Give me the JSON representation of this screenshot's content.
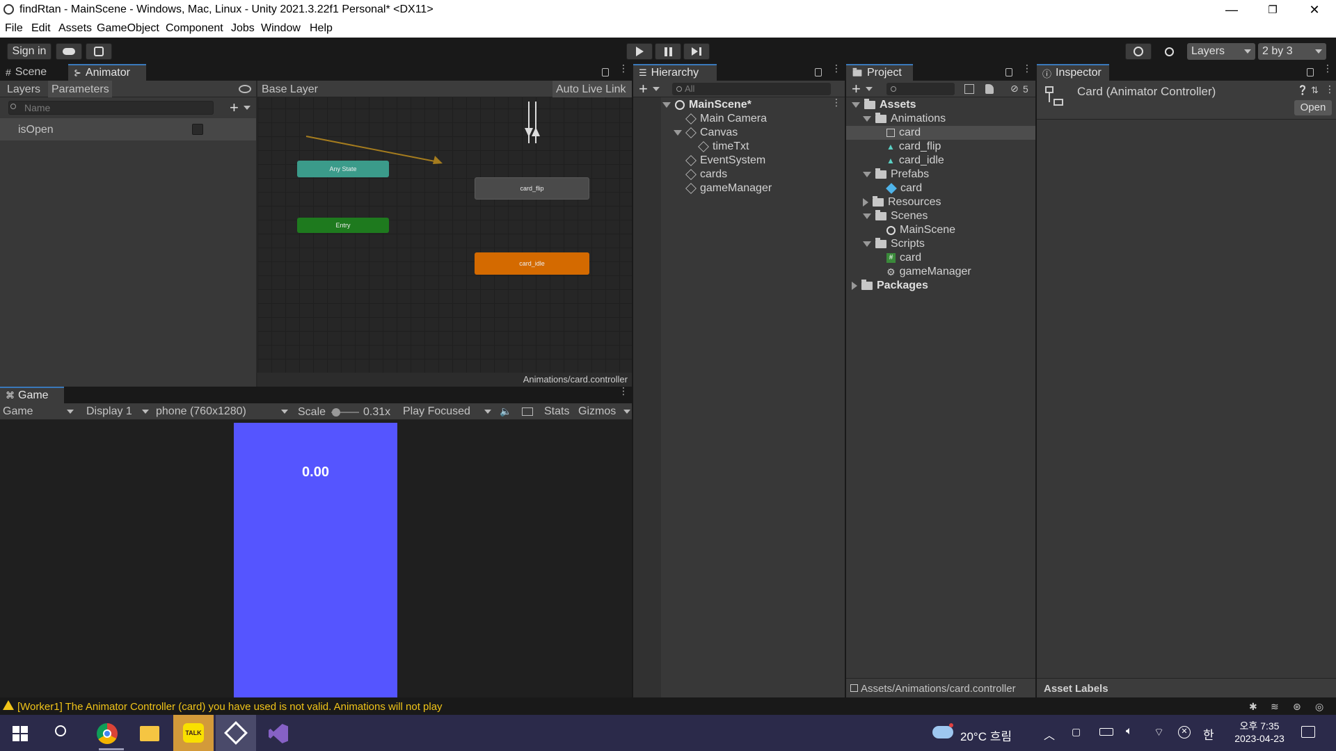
{
  "window": {
    "title": "findRtan - MainScene - Windows, Mac, Linux - Unity 2021.3.22f1 Personal* <DX11>",
    "minimize": "—",
    "restore": "❐",
    "close": "✕"
  },
  "menu": [
    "File",
    "Edit",
    "Assets",
    "GameObject",
    "Component",
    "Jobs",
    "Window",
    "Help"
  ],
  "toolbar": {
    "sign_in": "Sign in",
    "layers": "Layers",
    "layout": "2 by 3"
  },
  "scene_tabs": {
    "scene": "Scene",
    "animator": "Animator"
  },
  "animator": {
    "layers_tab": "Layers",
    "parameters_tab": "Parameters",
    "search_placeholder": "Name",
    "breadcrumb": "Base Layer",
    "auto_live_link": "Auto Live Link",
    "parameter": "isOpen",
    "nodes": {
      "any_state": "Any State",
      "entry": "Entry",
      "card_flip": "card_flip",
      "card_idle": "card_idle"
    },
    "footer": "Animations/card.controller"
  },
  "game": {
    "tab": "Game",
    "view_select": "Game",
    "display": "Display 1",
    "resolution": "phone (760x1280)",
    "scale_label": "Scale",
    "scale_value": "0.31x",
    "play_mode": "Play Focused",
    "stats": "Stats",
    "gizmos": "Gizmos",
    "timer": "0.00"
  },
  "hierarchy": {
    "tab": "Hierarchy",
    "search_placeholder": "All",
    "scene": "MainScene*",
    "items": [
      "Main Camera",
      "Canvas",
      "timeTxt",
      "EventSystem",
      "cards",
      "gameManager"
    ]
  },
  "project": {
    "tab": "Project",
    "hidden_count": "5",
    "assets": "Assets",
    "animations": "Animations",
    "anim_items": [
      "card",
      "card_flip",
      "card_idle"
    ],
    "prefabs": "Prefabs",
    "prefab_items": [
      "card"
    ],
    "resources": "Resources",
    "scenes": "Scenes",
    "scene_items": [
      "MainScene"
    ],
    "scripts": "Scripts",
    "script_items": [
      "card",
      "gameManager"
    ],
    "packages": "Packages",
    "footer": "Assets/Animations/card.controller"
  },
  "inspector": {
    "tab": "Inspector",
    "title": "Card (Animator Controller)",
    "open": "Open",
    "asset_labels": "Asset Labels"
  },
  "status": {
    "message": "[Worker1] The Animator Controller (card) you have used is not valid. Animations will not play"
  },
  "taskbar": {
    "weather": "20°C 흐림",
    "ime": "한",
    "time": "오후 7:35",
    "date": "2023-04-23"
  },
  "colors": {
    "accent": "#3a79bb",
    "game_bg": "#5555ff",
    "entry": "#1e7a1e",
    "any_state": "#3b9b8a",
    "card_idle": "#d46a00",
    "card_flip": "#4a4a4a",
    "warning": "#f0c419"
  }
}
